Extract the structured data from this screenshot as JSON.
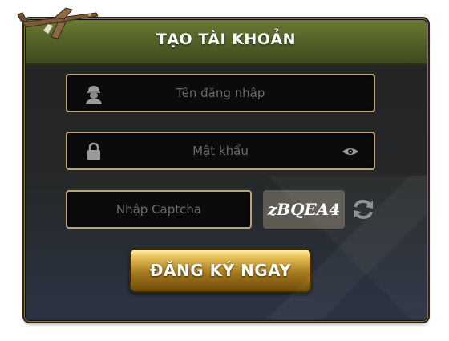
{
  "dialog": {
    "title": "TẠO TÀI KHOẢN",
    "logo_icon": "plane-logo-icon"
  },
  "form": {
    "username": {
      "placeholder": "Tên đăng nhập",
      "value": "",
      "icon": "soldier-user-icon"
    },
    "password": {
      "placeholder": "Mật khẩu",
      "value": "",
      "icon": "lock-icon",
      "toggle_icon": "eye-icon"
    },
    "captcha": {
      "placeholder": "Nhập Captcha",
      "value": "",
      "code": "zBQEA4",
      "refresh_icon": "refresh-icon"
    },
    "submit_label": "ĐĂNG KÝ NGAY"
  },
  "colors": {
    "header": "#55632a",
    "field_border": "#b9a478",
    "button_gold": "#a67a1e",
    "captcha_bg": "#5e5b55"
  }
}
